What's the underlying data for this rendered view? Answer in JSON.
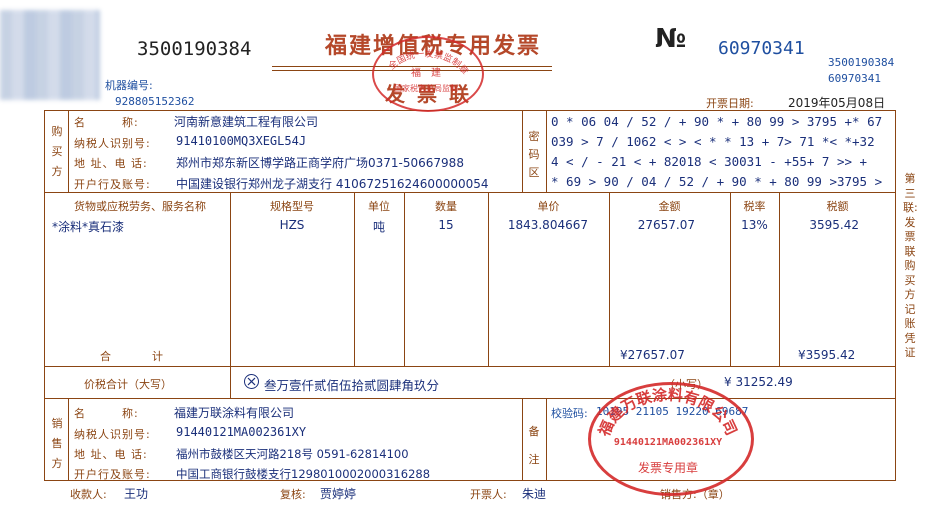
{
  "header": {
    "invoice_code_left": "3500190384",
    "title": "福建增值税专用发票",
    "subtitle": "发票联",
    "no_symbol": "№",
    "invoice_number": "60970341",
    "code_right_1": "3500190384",
    "code_right_2": "60970341",
    "machine_label": "机器编号:",
    "machine_number": "928805152362",
    "date_label": "开票日期:",
    "date": "2019年05月08日"
  },
  "buyer": {
    "side_label": "购买方",
    "name_label": "名　　　称:",
    "name": "河南新意建筑工程有限公司",
    "tax_label": "纳税人识别号:",
    "tax_id": "91410100MQ3XEGL54J",
    "addr_label": "地 址、电 话:",
    "addr": "郑州市郑东新区博学路正商学府广场0371-50667988",
    "bank_label": "开户行及账号:",
    "bank": "中国建设银行郑州龙子湖支行 41067251624600000054"
  },
  "cipher": {
    "label": "密码区",
    "lines": [
      "0 * 06 04 / 52 / + 90 * + 80 99 > 3795 +* 67",
      "039 > 7 / 1062 < > < * * 13 + 7> 71 *< *+32",
      "4 < / - 21 < + 82018 < 30031 - +55+ 7 >> +",
      "* 69 > 90 / 04 / 52 / + 90 * + 80 99  >3795 >"
    ]
  },
  "items": {
    "headers": [
      "货物或应税劳务、服务名称",
      "规格型号",
      "单位",
      "数量",
      "单价",
      "金额",
      "税率",
      "税额"
    ],
    "rows": [
      {
        "name": "*涂料*真石漆",
        "spec": "HZS",
        "unit": "吨",
        "qty": "15",
        "price": "1843.804667",
        "amount": "27657.07",
        "rate": "13%",
        "tax": "3595.42"
      }
    ],
    "total_label": "合　　　计",
    "total_amount": "¥27657.07",
    "total_tax": "¥3595.42"
  },
  "grand_total": {
    "label": "价税合计（大写）",
    "upper": "叁万壹仟贰佰伍拾贰圆肆角玖分",
    "small_label": "（小写）",
    "small": "¥ 31252.49"
  },
  "seller": {
    "side_label": "销售方",
    "name_label": "名　　　称:",
    "name": "福建万联涂料有限公司",
    "tax_label": "纳税人识别号:",
    "tax_id": "91440121MA002361XY",
    "addr_label": "地 址、电 话:",
    "addr": "福州市鼓楼区天河路218号 0591-62814100",
    "bank_label": "开户行及账号:",
    "bank": "中国工商银行鼓楼支行1298010002000316288",
    "remark_label": "备注",
    "check_label": "校验码:",
    "check_code": "10195 21105 19220 69687"
  },
  "footer": {
    "payee_label": "收款人:",
    "payee": "王功",
    "reviewer_label": "复核:",
    "reviewer": "贾婷婷",
    "drawer_label": "开票人:",
    "drawer": "朱迪",
    "seller_label": "销售方:（章）"
  },
  "side_note": "第三联:发票联　购买方记账凭证",
  "stamps": {
    "top_ring": "全国统一发票监制章",
    "top_center": "福　建",
    "top_bottom": "国家税务总局监制",
    "seller_ring": "福建万联涂料有限公司",
    "seller_id": "91440121MA002361XY",
    "seller_bottom": "发票专用章"
  }
}
